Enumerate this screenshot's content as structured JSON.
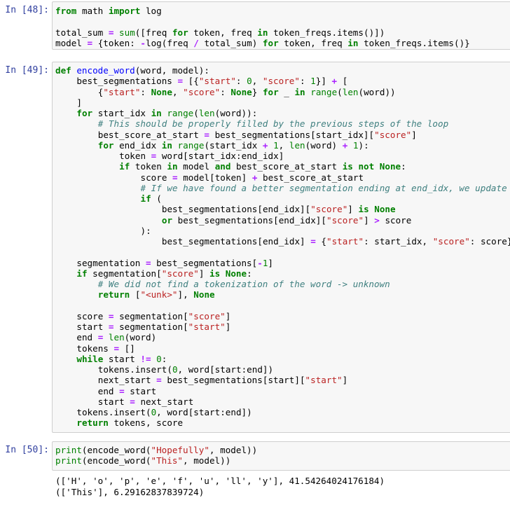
{
  "cells": [
    {
      "prompt": "In [48]:",
      "code": [
        "from math import log",
        "",
        "total_sum = sum([freq for token, freq in token_freqs.items()])",
        "model = {token: -log(freq / total_sum) for token, freq in token_freqs.items()}"
      ]
    },
    {
      "prompt": "In [49]:",
      "code": [
        "def encode_word(word, model):",
        "    best_segmentations = [{\"start\": 0, \"score\": 1}] + [",
        "        {\"start\": None, \"score\": None} for _ in range(len(word))",
        "    ]",
        "    for start_idx in range(len(word)):",
        "        # This should be properly filled by the previous steps of the loop",
        "        best_score_at_start = best_segmentations[start_idx][\"score\"]",
        "        for end_idx in range(start_idx + 1, len(word) + 1):",
        "            token = word[start_idx:end_idx]",
        "            if token in model and best_score_at_start is not None:",
        "                score = model[token] + best_score_at_start",
        "                # If we have found a better segmentation ending at end_idx, we update",
        "                if (",
        "                    best_segmentations[end_idx][\"score\"] is None",
        "                    or best_segmentations[end_idx][\"score\"] > score",
        "                ):",
        "                    best_segmentations[end_idx] = {\"start\": start_idx, \"score\": score}",
        "",
        "    segmentation = best_segmentations[-1]",
        "    if segmentation[\"score\"] is None:",
        "        # We did not find a tokenization of the word -> unknown",
        "        return [\"<unk>\"], None",
        "",
        "    score = segmentation[\"score\"]",
        "    start = segmentation[\"start\"]",
        "    end = len(word)",
        "    tokens = []",
        "    while start != 0:",
        "        tokens.insert(0, word[start:end])",
        "        next_start = best_segmentations[start][\"start\"]",
        "        end = start",
        "        start = next_start",
        "    tokens.insert(0, word[start:end])",
        "    return tokens, score"
      ]
    },
    {
      "prompt": "In [50]:",
      "code": [
        "print(encode_word(\"Hopefully\", model))",
        "print(encode_word(\"This\", model))"
      ],
      "output": [
        "(['H', 'o', 'p', 'e', 'f', 'u', 'll', 'y'], 41.5426402417618​4)",
        "(['This'], 6.29162837839724)"
      ]
    }
  ]
}
